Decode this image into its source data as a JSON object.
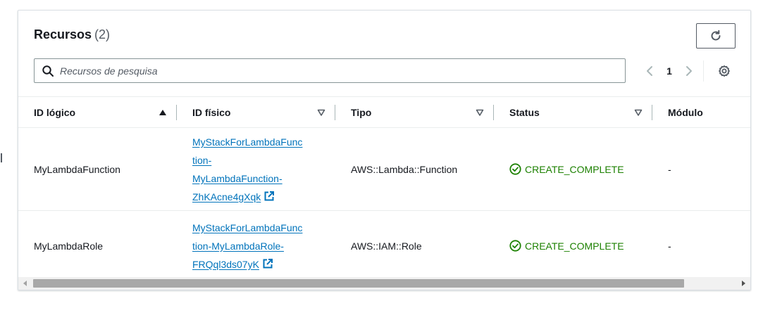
{
  "header": {
    "title": "Recursos",
    "count": "(2)"
  },
  "search": {
    "placeholder": "Recursos de pesquisa",
    "value": ""
  },
  "pagination": {
    "current_page": "1"
  },
  "table": {
    "columns": [
      {
        "label": "ID lógico",
        "sort": "ascending"
      },
      {
        "label": "ID físico",
        "sort": "none"
      },
      {
        "label": "Tipo",
        "sort": "none"
      },
      {
        "label": "Status",
        "sort": "none"
      },
      {
        "label": "Módulo",
        "sort": "none"
      }
    ],
    "rows": [
      {
        "logical_id": "MyLambdaFunction",
        "physical_id_lines": [
          "MyStackForLambdaFunc",
          "tion-",
          "MyLambdaFunction-",
          "ZhKAcne4gXqk"
        ],
        "type": "AWS::Lambda::Function",
        "status": "CREATE_COMPLETE",
        "module": "-"
      },
      {
        "logical_id": "MyLambdaRole",
        "physical_id_lines": [
          "MyStackForLambdaFunc",
          "tion-MyLambdaRole-",
          "FRQql3ds07yK"
        ],
        "type": "AWS::IAM::Role",
        "status": "CREATE_COMPLETE",
        "module": "-"
      }
    ]
  },
  "colors": {
    "link": "#0073bb",
    "success": "#1d8102",
    "border": "#eaeded",
    "text": "#16191f"
  },
  "icons": {
    "refresh": "refresh-icon",
    "search": "search-icon",
    "settings": "gear-icon",
    "external": "external-link-icon",
    "status_ok": "check-circle-icon"
  }
}
